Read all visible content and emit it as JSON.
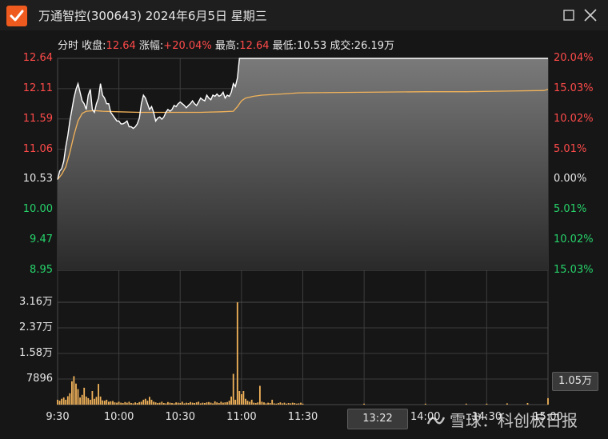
{
  "window": {
    "title": "万通智控(300643) 2024年6月5日 星期三"
  },
  "info": {
    "label_fenshi": "分时",
    "label_close": "收盘:",
    "close": "12.64",
    "label_change": "涨幅:",
    "change": "+20.04%",
    "label_high": "最高:",
    "high": "12.64",
    "label_low": "最低:",
    "low": "10.53",
    "label_volume": "成交:",
    "volume": "26.19万"
  },
  "chart_data": {
    "type": "line",
    "price_ticks": [
      "12.64",
      "12.11",
      "11.59",
      "11.06",
      "10.53",
      "10.00",
      "9.47",
      "8.95"
    ],
    "pct_ticks": [
      "20.04%",
      "15.03%",
      "10.02%",
      "5.01%",
      "0.00%",
      "5.01%",
      "10.02%",
      "15.03%"
    ],
    "vol_ticks": [
      "3.16万",
      "2.37万",
      "1.58万",
      "7896"
    ],
    "x_ticks": [
      "9:30",
      "10:00",
      "10:30",
      "11:00",
      "11:30",
      "13:22",
      "14:00",
      "14:30",
      "15:00"
    ],
    "ylim_price": [
      8.95,
      12.64
    ],
    "prev_close": 10.53,
    "series": [
      {
        "name": "价格",
        "color": "#ffffff",
        "x": [
          0,
          1,
          2,
          3,
          4,
          5,
          6,
          7,
          8,
          9,
          10,
          11,
          12,
          13,
          14,
          15,
          16,
          17,
          18,
          19,
          20,
          21,
          22,
          23,
          24,
          25,
          26,
          27,
          28,
          29,
          30,
          31,
          32,
          33,
          34,
          35,
          36,
          37,
          38,
          39,
          40,
          41,
          42,
          43,
          44,
          45,
          46,
          47,
          48,
          49,
          50,
          51,
          52,
          53,
          54,
          55,
          56,
          57,
          58,
          59,
          60,
          61,
          62,
          63,
          64,
          65,
          66,
          67,
          68,
          69,
          70,
          71,
          72,
          73,
          74,
          75,
          76,
          77,
          78,
          79,
          80,
          81,
          82,
          83,
          84,
          85,
          86,
          87,
          88,
          89,
          90,
          91,
          92,
          93,
          94,
          95,
          96,
          97,
          98,
          99,
          100,
          101,
          102,
          103,
          104,
          105,
          106,
          107,
          108,
          109,
          110,
          111,
          112,
          113,
          114,
          115,
          116,
          117,
          118,
          119,
          240
        ],
        "y": [
          10.53,
          10.68,
          10.72,
          10.85,
          11.1,
          11.3,
          11.55,
          11.75,
          11.95,
          12.1,
          12.2,
          12.05,
          11.9,
          11.85,
          11.75,
          12.0,
          12.1,
          11.75,
          11.7,
          11.85,
          11.95,
          12.2,
          12.0,
          11.95,
          11.85,
          11.85,
          11.7,
          11.65,
          11.6,
          11.55,
          11.55,
          11.5,
          11.5,
          11.52,
          11.55,
          11.45,
          11.45,
          11.42,
          11.45,
          11.5,
          11.6,
          11.85,
          12.0,
          11.95,
          11.85,
          11.75,
          11.8,
          11.7,
          11.55,
          11.6,
          11.62,
          11.58,
          11.62,
          11.7,
          11.75,
          11.72,
          11.75,
          11.82,
          11.8,
          11.85,
          11.88,
          11.85,
          11.82,
          11.78,
          11.82,
          11.85,
          11.9,
          11.85,
          11.82,
          11.88,
          11.95,
          11.92,
          11.9,
          12.0,
          11.95,
          11.92,
          12.0,
          11.98,
          12.02,
          11.98,
          12.0,
          12.05,
          11.95,
          12.0,
          11.98,
          12.05,
          12.2,
          12.15,
          12.3,
          12.64,
          12.64,
          12.64,
          12.64,
          12.64,
          12.64,
          12.64,
          12.64,
          12.64,
          12.64,
          12.64,
          12.64,
          12.64,
          12.64,
          12.64,
          12.64,
          12.64,
          12.64,
          12.64,
          12.64,
          12.64,
          12.64,
          12.64,
          12.64,
          12.64,
          12.64,
          12.64,
          12.64,
          12.64,
          12.64,
          12.64,
          12.64
        ]
      },
      {
        "name": "均价",
        "color": "#f2b35a",
        "x": [
          0,
          2,
          4,
          6,
          8,
          10,
          12,
          14,
          18,
          22,
          30,
          40,
          50,
          60,
          70,
          80,
          86,
          88,
          90,
          92,
          96,
          100,
          110,
          118,
          150,
          180,
          200,
          220,
          238,
          240
        ],
        "y": [
          10.53,
          10.62,
          10.75,
          11.0,
          11.3,
          11.55,
          11.68,
          11.72,
          11.73,
          11.72,
          11.71,
          11.7,
          11.7,
          11.7,
          11.7,
          11.71,
          11.72,
          11.8,
          11.9,
          11.95,
          11.98,
          12.0,
          12.02,
          12.04,
          12.05,
          12.06,
          12.06,
          12.07,
          12.08,
          12.1
        ]
      }
    ],
    "volume": {
      "x": [
        0,
        1,
        2,
        3,
        4,
        5,
        6,
        7,
        8,
        9,
        10,
        11,
        12,
        13,
        14,
        15,
        16,
        17,
        18,
        19,
        20,
        21,
        22,
        23,
        24,
        25,
        26,
        27,
        28,
        29,
        30,
        31,
        32,
        33,
        34,
        35,
        36,
        37,
        38,
        39,
        40,
        41,
        42,
        43,
        44,
        45,
        46,
        47,
        48,
        49,
        50,
        51,
        52,
        53,
        54,
        55,
        56,
        57,
        58,
        59,
        60,
        61,
        62,
        63,
        64,
        65,
        66,
        67,
        68,
        69,
        70,
        71,
        72,
        73,
        74,
        75,
        76,
        77,
        78,
        79,
        80,
        81,
        82,
        83,
        84,
        85,
        86,
        87,
        88,
        89,
        90,
        91,
        92,
        93,
        94,
        95,
        96,
        97,
        98,
        99,
        100,
        101,
        102,
        103,
        104,
        105,
        106,
        107,
        108,
        109,
        110,
        111,
        112,
        113,
        114,
        115,
        116,
        117,
        118,
        119,
        120,
        150,
        180,
        200,
        210,
        220,
        230,
        240
      ],
      "values": [
        1500,
        1200,
        1800,
        2200,
        1500,
        2600,
        3500,
        7200,
        8800,
        6500,
        4800,
        2200,
        3000,
        5200,
        2500,
        2000,
        1500,
        4200,
        1800,
        2400,
        6400,
        2500,
        1300,
        1200,
        1500,
        900,
        1000,
        1100,
        700,
        600,
        900,
        600,
        500,
        800,
        600,
        900,
        500,
        400,
        700,
        500,
        800,
        900,
        1500,
        1800,
        1200,
        2400,
        1500,
        900,
        700,
        500,
        600,
        900,
        500,
        400,
        800,
        600,
        500,
        400,
        700,
        600,
        500,
        900,
        400,
        600,
        500,
        800,
        600,
        500,
        700,
        900,
        400,
        600,
        500,
        700,
        800,
        600,
        400,
        1000,
        700,
        500,
        900,
        600,
        700,
        800,
        1200,
        2500,
        9500,
        1500,
        31600,
        4200,
        3200,
        4200,
        1800,
        1200,
        900,
        1500,
        600,
        500,
        700,
        5800,
        900,
        700,
        400,
        600,
        500,
        1500,
        400,
        300,
        500,
        700,
        400,
        600,
        300,
        500,
        400,
        600,
        500,
        300,
        400,
        600,
        300,
        300,
        300,
        300,
        300,
        400,
        500,
        2000
      ]
    }
  },
  "overlay": {
    "time_marker": "13:22",
    "volume_marker": "1.05万",
    "watermark": "雪球：科创板日报"
  },
  "colors": {
    "up": "#ff4a4a",
    "down": "#26d26a",
    "price_line": "#ffffff",
    "avg_line": "#f2b35a",
    "volume_bar": "#f2b35a",
    "brand": "#ef5a1e"
  }
}
